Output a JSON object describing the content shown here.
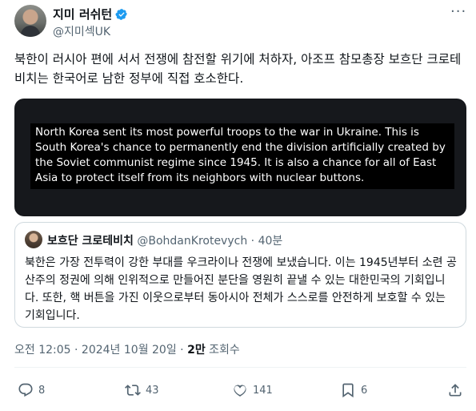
{
  "author": {
    "display_name": "지미 러쉬턴",
    "handle": "@지미섹UK"
  },
  "tweet": {
    "text": "북한이 러시아 편에 서서 전쟁에 참전할 위기에 처하자, 아조프 참모총장 보흐단 크로테비치는 한국어로 남한 정부에 직접 호소한다."
  },
  "media": {
    "caption": "North Korea sent its most powerful troops to the war in Ukraine. This is South Korea's chance to permanently end the division artificially created by the Soviet communist regime since 1945. It is also a chance for all of East Asia to protect itself from its neighbors with nuclear buttons."
  },
  "quote": {
    "name": "보흐단 크로테비치",
    "handle": "@BohdanKrotevych",
    "separator": " · ",
    "time": "40분",
    "text": "북한은 가장 전투력이 강한 부대를 우크라이나 전쟁에 보냈습니다. 이는 1945년부터 소련 공산주의 정권에 의해 인위적으로 만들어진 분단을 영원히 끝낼 수 있는 대한민국의 기회입니다. 또한, 핵 버튼을 가진 이웃으로부터 동아시아 전체가 스스로를 안전하게 보호할 수 있는 기회입니다."
  },
  "meta": {
    "time": "오전 12:05",
    "dot": " · ",
    "date": "2024년 10월 20일",
    "views_count": "2만",
    "views_label": " 조회수"
  },
  "actions": {
    "replies": "8",
    "retweets": "43",
    "likes": "141",
    "bookmarks": "6"
  },
  "colors": {
    "verified": "#1d9bf0",
    "secondary_text": "#536471",
    "media_bg": "#16181c"
  },
  "icons": [
    "verified-badge-icon",
    "more-icon",
    "reply-icon",
    "retweet-icon",
    "like-icon",
    "bookmark-icon",
    "share-icon"
  ]
}
